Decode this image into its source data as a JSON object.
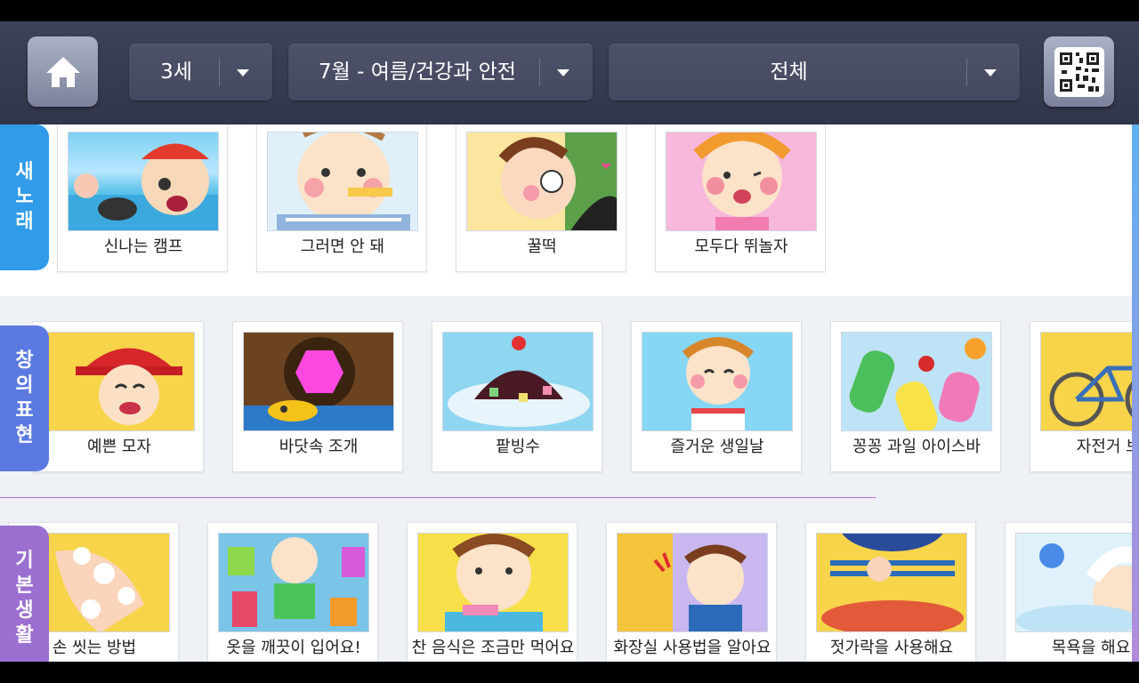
{
  "header": {
    "age_select": "3세",
    "theme_select": "7월 - 여름/건강과 안전",
    "filter_select": "전체"
  },
  "icons": {
    "home": "home-icon",
    "qr": "qr-code-icon",
    "dropdown": "chevron-down-icon"
  },
  "sections": [
    {
      "tab": "새노래",
      "color": "#2f9be9",
      "cards": [
        "신나는 캠프",
        "그러면 안 돼",
        "꿀떡",
        "모두다 뛰놀자"
      ]
    },
    {
      "tab": "창의표현",
      "color": "#5b79e0",
      "cards": [
        "예쁜 모자",
        "바닷속 조개",
        "팥빙수",
        "즐거운 생일날",
        "꽁꽁 과일 아이스바",
        "자전거 보호"
      ]
    },
    {
      "tab": "기본생활",
      "color": "#9b6fd0",
      "cards": [
        "손 씻는 방법",
        "옷을 깨끗이 입어요!",
        "찬 음식은 조금만 먹어요",
        "화장실 사용법을 알아요",
        "젓가락을 사용해요",
        "목욕을 해요"
      ]
    }
  ]
}
